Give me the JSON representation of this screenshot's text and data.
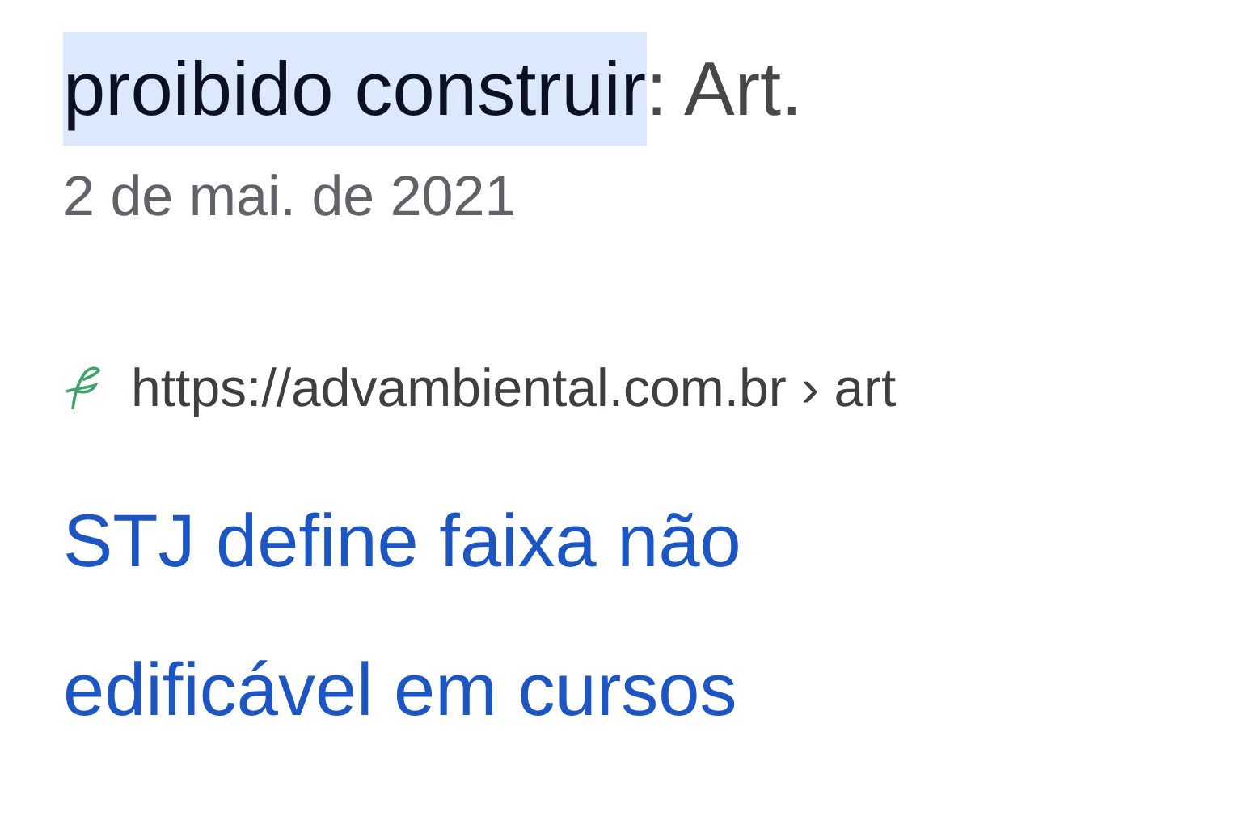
{
  "snippet": [
    {
      "text": "proibido construir",
      "highlighted": true
    },
    {
      "text": ": Art.",
      "highlighted": false
    }
  ],
  "date": "2 de mai. de 2021",
  "result": {
    "url": "https://advambiental.com.br › art",
    "title_lines": [
      "STJ define faixa não",
      "edificável em cursos"
    ]
  }
}
